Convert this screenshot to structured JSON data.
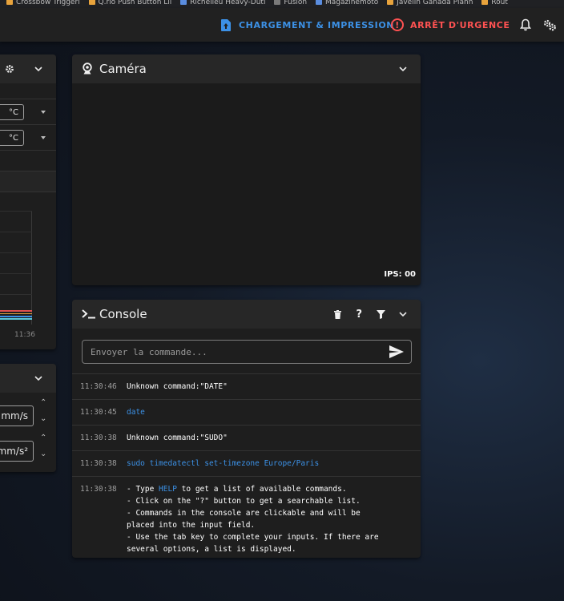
{
  "bookmarks": [
    "Crossbow Triggeri",
    "Q.rlo Push Button Lil",
    "Richelieu Heavy-Duti",
    "Fusion",
    "Magazinemoto",
    "Javelin Ganada Plann",
    "Rout"
  ],
  "topbar": {
    "loading_label": "CHARGEMENT & IMPRESSION",
    "emergency_label": "ARRÊT D'URGENCE",
    "accent": "#3c91e6",
    "danger": "#ff5252"
  },
  "left_panel": {
    "unit_1": "°C",
    "unit_2": "°C",
    "chart_tick": "11:36"
  },
  "motion_panel": {
    "speed_unit": "mm/s",
    "accel_unit": "mm/s²"
  },
  "camera": {
    "title": "Caméra",
    "fps": "IPS: 00"
  },
  "console": {
    "title": "Console",
    "placeholder": "Envoyer la commande...",
    "help_button": "?",
    "log": [
      {
        "time": "11:30:46",
        "text": "Unknown command:\"DATE\"",
        "kind": "response"
      },
      {
        "time": "11:30:45",
        "text": "date",
        "kind": "command"
      },
      {
        "time": "11:30:38",
        "text": "Unknown command:\"SUDO\"",
        "kind": "response"
      },
      {
        "time": "11:30:38",
        "text": "sudo timedatectl set-timezone Europe/Paris",
        "kind": "command"
      }
    ],
    "help": {
      "time": "11:30:38",
      "line1_pre": "- Type ",
      "line1_link": "HELP",
      "line1_post": " to get a list of available commands.",
      "rest": "- Click on the \"?\" button to get a searchable list.\n- Commands in the console are clickable and will be\nplaced into the input field.\n- Use the tab key to complete your inputs. If there are\nseveral options, a list is displayed."
    }
  }
}
